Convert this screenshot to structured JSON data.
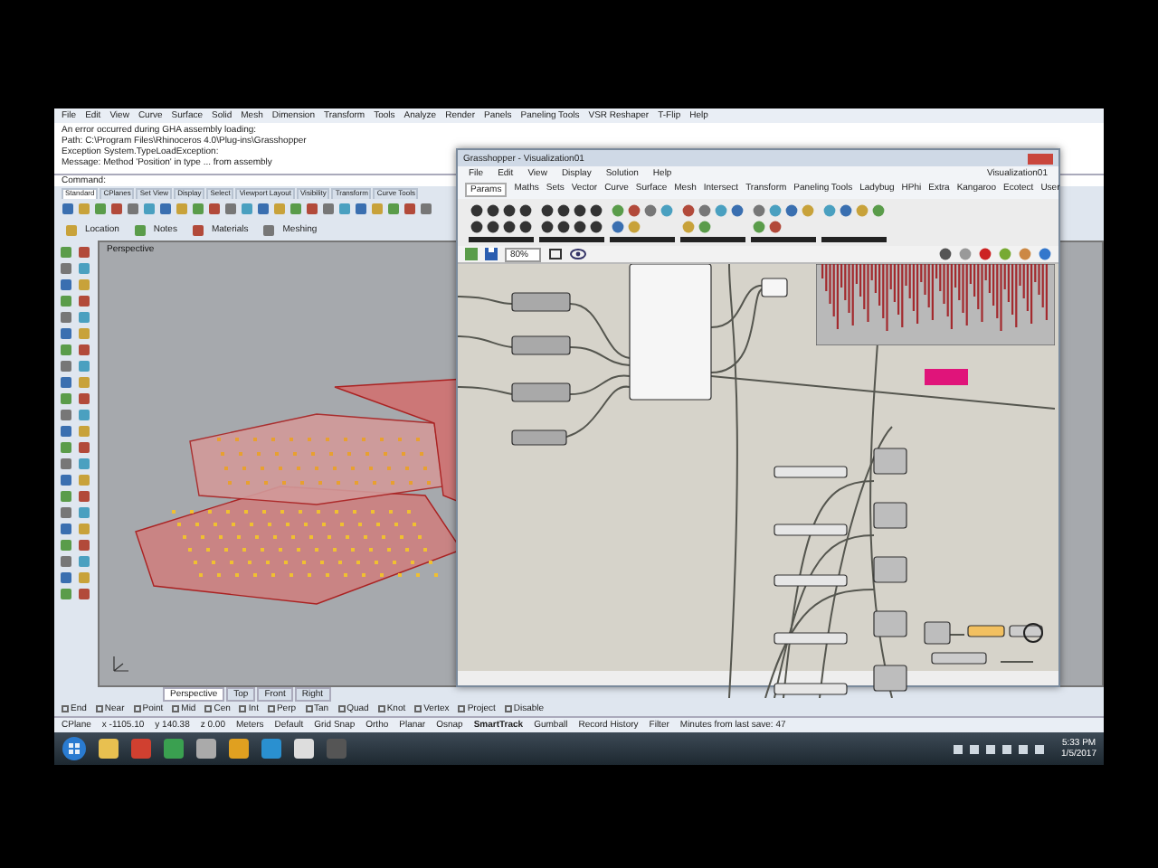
{
  "rhino": {
    "menu": [
      "File",
      "Edit",
      "View",
      "Curve",
      "Surface",
      "Solid",
      "Mesh",
      "Dimension",
      "Transform",
      "Tools",
      "Analyze",
      "Render",
      "Panels",
      "Paneling Tools",
      "VSR Reshaper",
      "T-Flip",
      "Help"
    ],
    "command_history": [
      "An error occurred during GHA assembly loading:",
      "Path: C:\\Program Files\\Rhinoceros 4.0\\Plug-ins\\Grasshopper",
      "Exception System.TypeLoadException:",
      "Message: Method 'Position' in type ... from assembly"
    ],
    "command_label": "Command:",
    "toolbar_tabs": [
      {
        "label": "Standard",
        "selected": true
      },
      {
        "label": "CPlanes",
        "selected": false
      },
      {
        "label": "Set View",
        "selected": false
      },
      {
        "label": "Display",
        "selected": false
      },
      {
        "label": "Select",
        "selected": false
      },
      {
        "label": "Viewport Layout",
        "selected": false
      },
      {
        "label": "Visibility",
        "selected": false
      },
      {
        "label": "Transform",
        "selected": false
      },
      {
        "label": "Curve Tools",
        "selected": false
      }
    ],
    "panel_tabs": [
      "Location",
      "Notes",
      "Materials",
      "Meshing"
    ],
    "viewport_label": "Perspective",
    "viewport_tabs": [
      {
        "label": "Perspective",
        "selected": true
      },
      {
        "label": "Top",
        "selected": false
      },
      {
        "label": "Front",
        "selected": false
      },
      {
        "label": "Right",
        "selected": false
      }
    ],
    "osnaps": [
      {
        "label": "End",
        "checked": false
      },
      {
        "label": "Near",
        "checked": false
      },
      {
        "label": "Point",
        "checked": false
      },
      {
        "label": "Mid",
        "checked": false
      },
      {
        "label": "Cen",
        "checked": false
      },
      {
        "label": "Int",
        "checked": false
      },
      {
        "label": "Perp",
        "checked": false
      },
      {
        "label": "Tan",
        "checked": false
      },
      {
        "label": "Quad",
        "checked": false
      },
      {
        "label": "Knot",
        "checked": false
      },
      {
        "label": "Vertex",
        "checked": false
      },
      {
        "label": "Project",
        "checked": false
      },
      {
        "label": "Disable",
        "checked": false
      }
    ],
    "status_coords": [
      "CPlane",
      "x -1105.10",
      "y 140.38",
      "z 0.00",
      "Meters",
      "Default"
    ],
    "status_toggles": [
      {
        "label": "Grid Snap",
        "on": false
      },
      {
        "label": "Ortho",
        "on": false
      },
      {
        "label": "Planar",
        "on": false
      },
      {
        "label": "Osnap",
        "on": false
      },
      {
        "label": "SmartTrack",
        "on": true
      },
      {
        "label": "Gumball",
        "on": false
      },
      {
        "label": "Record History",
        "on": false
      },
      {
        "label": "Filter",
        "on": false
      }
    ],
    "status_message": "Minutes from last save: 47"
  },
  "grasshopper": {
    "title": "Grasshopper - Visualization01",
    "menu": [
      "File",
      "Edit",
      "View",
      "Display",
      "Solution",
      "Help"
    ],
    "document_name": "Visualization01",
    "tabs": [
      {
        "label": "Params",
        "selected": true
      },
      {
        "label": "Maths",
        "selected": false
      },
      {
        "label": "Sets",
        "selected": false
      },
      {
        "label": "Vector",
        "selected": false
      },
      {
        "label": "Curve",
        "selected": false
      },
      {
        "label": "Surface",
        "selected": false
      },
      {
        "label": "Mesh",
        "selected": false
      },
      {
        "label": "Intersect",
        "selected": false
      },
      {
        "label": "Transform",
        "selected": false
      },
      {
        "label": "Paneling Tools",
        "selected": false
      },
      {
        "label": "Ladybug",
        "selected": false
      },
      {
        "label": "HPhi",
        "selected": false
      },
      {
        "label": "Extra",
        "selected": false
      },
      {
        "label": "Kangaroo",
        "selected": false
      },
      {
        "label": "Ecotect",
        "selected": false
      },
      {
        "label": "User",
        "selected": false
      }
    ],
    "zoom": "80%"
  },
  "taskbar": {
    "time": "5:33 PM",
    "date": "1/5/2017"
  }
}
